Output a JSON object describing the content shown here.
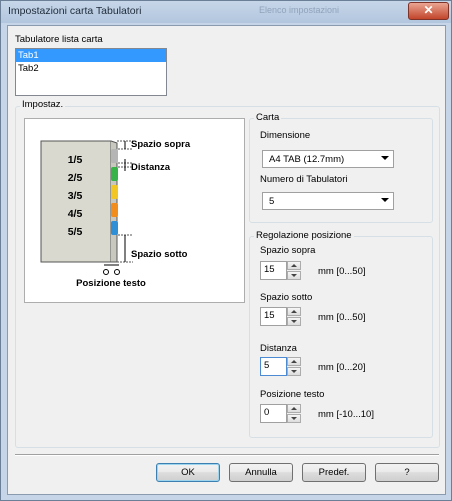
{
  "window": {
    "title": "Impostazioni carta Tabulatori",
    "background_title": "Elenco impostazioni"
  },
  "tab_list": {
    "label": "Tabulatore lista carta",
    "items": [
      "Tab1",
      "Tab2"
    ],
    "selected": 0
  },
  "settings": {
    "group_label": "Impostaz.",
    "preview": {
      "tab_labels": [
        "1/5",
        "2/5",
        "3/5",
        "4/5",
        "5/5"
      ],
      "tab_colors": [
        "#b5b5b5",
        "#37b34a",
        "#f2c623",
        "#f28c1a",
        "#2e8fd6"
      ],
      "annotation_top": "Spazio sopra",
      "annotation_distance": "Distanza",
      "annotation_bottom": "Spazio sotto",
      "annotation_text_position": "Posizione testo"
    }
  },
  "carta": {
    "group_label": "Carta",
    "dimension_label": "Dimensione",
    "dimension_value": "A4 TAB (12.7mm)",
    "tab_count_label": "Numero di Tabulatori",
    "tab_count_value": "5"
  },
  "position": {
    "group_label": "Regolazione posizione",
    "top_label": "Spazio sopra",
    "top_value": "15",
    "top_range": "mm [0...50]",
    "bottom_label": "Spazio sotto",
    "bottom_value": "15",
    "bottom_range": "mm [0...50]",
    "distance_label": "Distanza",
    "distance_value": "5",
    "distance_range": "mm [0...20]",
    "text_pos_label": "Posizione testo",
    "text_pos_value": "0",
    "text_pos_range": "mm [-10...10]"
  },
  "buttons": {
    "ok": "OK",
    "cancel": "Annulla",
    "default": "Predef.",
    "help": "?"
  },
  "icons": {
    "close": "close-icon",
    "dropdown": "chevron-down-icon",
    "spin_up": "arrow-up-icon",
    "spin_down": "arrow-down-icon"
  }
}
